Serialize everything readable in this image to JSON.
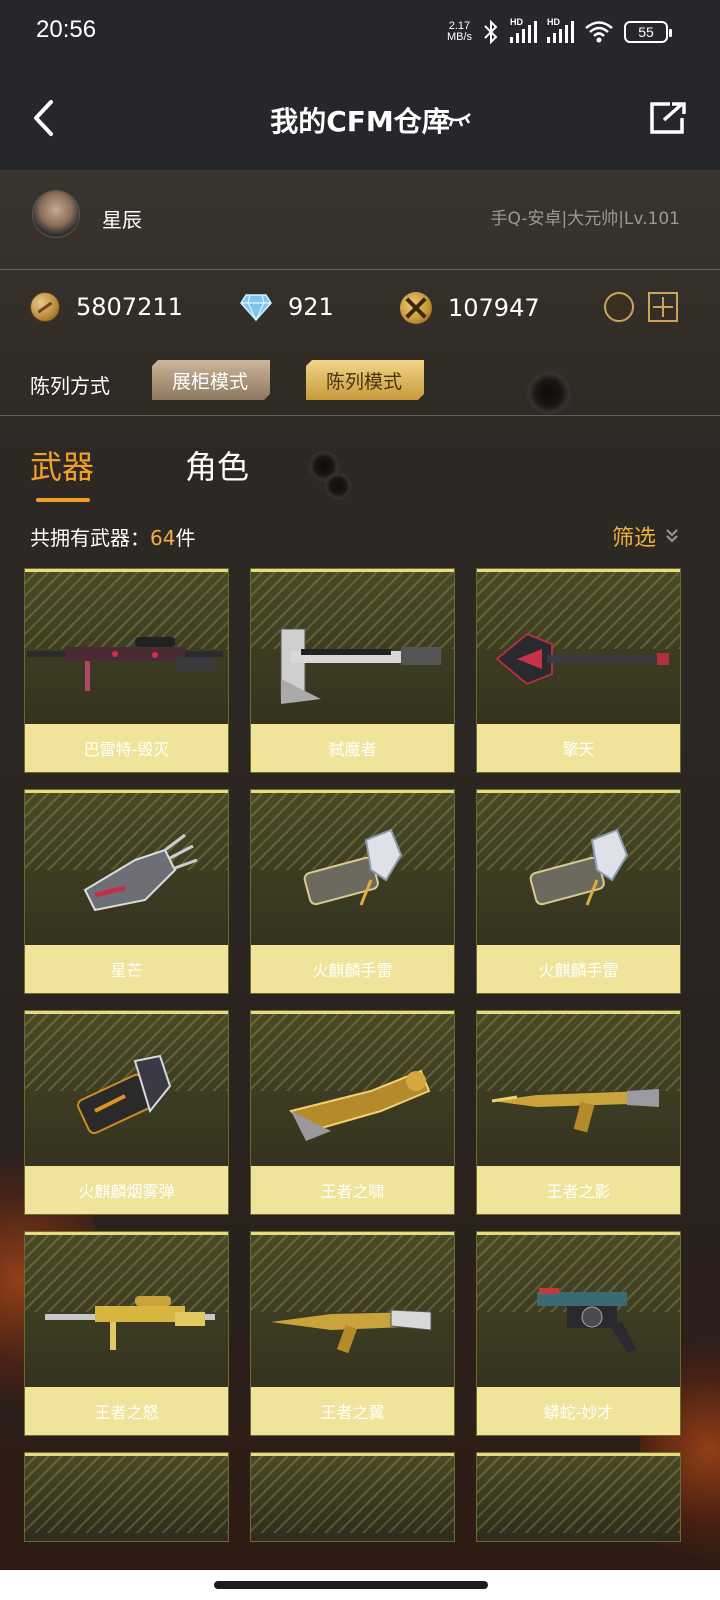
{
  "status": {
    "time": "20:56",
    "net_speed_value": "2.17",
    "net_speed_unit": "MB/s",
    "signal1_label": "HD",
    "signal2_label": "HD",
    "battery": "55"
  },
  "header": {
    "title": "我的CFM仓库"
  },
  "profile": {
    "name": "星辰",
    "rank": "手Q-安卓|大元帅|Lv.101"
  },
  "currencies": {
    "gold": "5807211",
    "diamond": "921",
    "honor": "107947"
  },
  "display_mode": {
    "label": "陈列方式",
    "cabinet_label": "展柜模式",
    "list_label": "陈列模式"
  },
  "tabs": {
    "weapons": "武器",
    "roles": "角色"
  },
  "inventory": {
    "count_prefix": "共拥有武器：",
    "count": "64",
    "count_suffix": "件",
    "filter_label": "筛选"
  },
  "weapons": [
    {
      "name": "巴雷特-毁灭",
      "kind": "sniper"
    },
    {
      "name": "弑魔者",
      "kind": "heavy"
    },
    {
      "name": "擎天",
      "kind": "shovel"
    },
    {
      "name": "星芒",
      "kind": "gauntlet"
    },
    {
      "name": "火麒麟手雷",
      "kind": "grenade"
    },
    {
      "name": "火麒麟手雷",
      "kind": "grenade"
    },
    {
      "name": "火麒麟烟雾弹",
      "kind": "smoke"
    },
    {
      "name": "王者之啸",
      "kind": "launcher"
    },
    {
      "name": "王者之影",
      "kind": "rifle"
    },
    {
      "name": "王者之怒",
      "kind": "gold-sniper"
    },
    {
      "name": "王者之翼",
      "kind": "gold-rifle"
    },
    {
      "name": "蟒蛇-妙才",
      "kind": "revolver"
    }
  ],
  "colors": {
    "accent": "#f0a02a",
    "card_label_bg": "#efe49a",
    "card_border": "#e6db7e"
  }
}
